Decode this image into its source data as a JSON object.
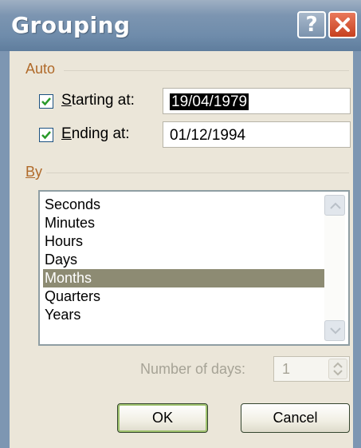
{
  "window": {
    "title": "Grouping",
    "help_glyph": "?",
    "close_icon": "close-icon",
    "colors": {
      "titlebar": "#7c95b1",
      "close": "#c6401f",
      "accent_label": "#b06a2a",
      "selection": "#8d8b73"
    }
  },
  "auto": {
    "group_label": "Auto",
    "starting": {
      "checked": true,
      "label_ul": "S",
      "label_rest": "tarting at:",
      "value": "19/04/1979"
    },
    "ending": {
      "checked": true,
      "label_ul": "E",
      "label_rest": "nding at:",
      "value": "01/12/1994"
    }
  },
  "by": {
    "group_label_ul": "B",
    "group_label_rest": "y",
    "items": [
      "Seconds",
      "Minutes",
      "Hours",
      "Days",
      "Months",
      "Quarters",
      "Years"
    ],
    "selected": "Months"
  },
  "days": {
    "label": "Number of days:",
    "value": "1",
    "enabled": false
  },
  "buttons": {
    "ok": "OK",
    "cancel": "Cancel"
  }
}
